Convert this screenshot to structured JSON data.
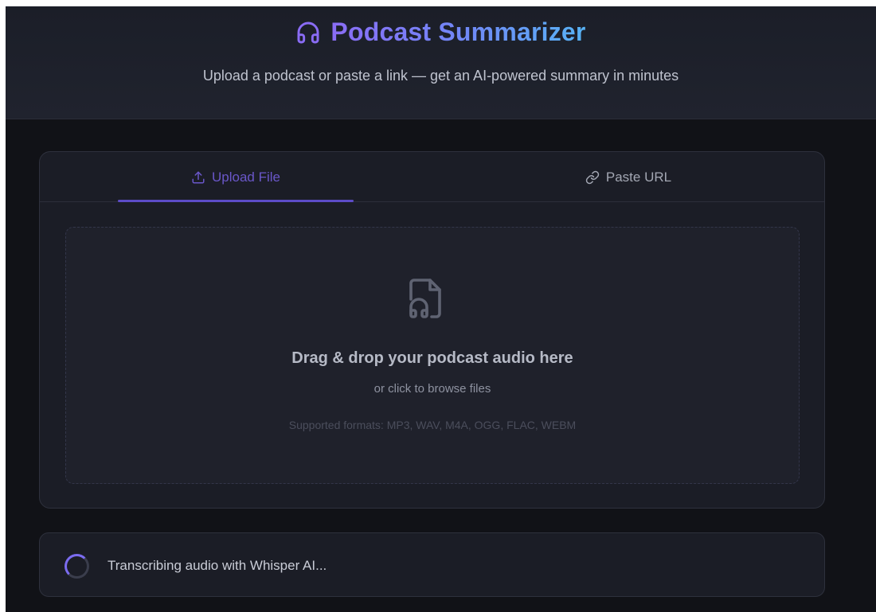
{
  "header": {
    "title": "Podcast Summarizer",
    "subtitle": "Upload a podcast or paste a link — get an AI-powered summary in minutes",
    "icon": "headphones-icon",
    "title_gradient": [
      "#8a6cf5",
      "#57b3f5"
    ]
  },
  "tabs": [
    {
      "label": "Upload File",
      "icon": "upload-icon",
      "active": true
    },
    {
      "label": "Paste URL",
      "icon": "link-icon",
      "active": false
    }
  ],
  "dropzone": {
    "icon": "audio-file-icon",
    "title": "Drag & drop your podcast audio here",
    "subtitle": "or click to browse files",
    "formats": "Supported formats: MP3, WAV, M4A, OGG, FLAC, WEBM"
  },
  "status": {
    "text": "Transcribing audio with Whisper AI...",
    "icon": "spinner-icon"
  },
  "colors": {
    "accent": "#5c4cc7",
    "background": "#111217",
    "card": "#1b1d26"
  }
}
